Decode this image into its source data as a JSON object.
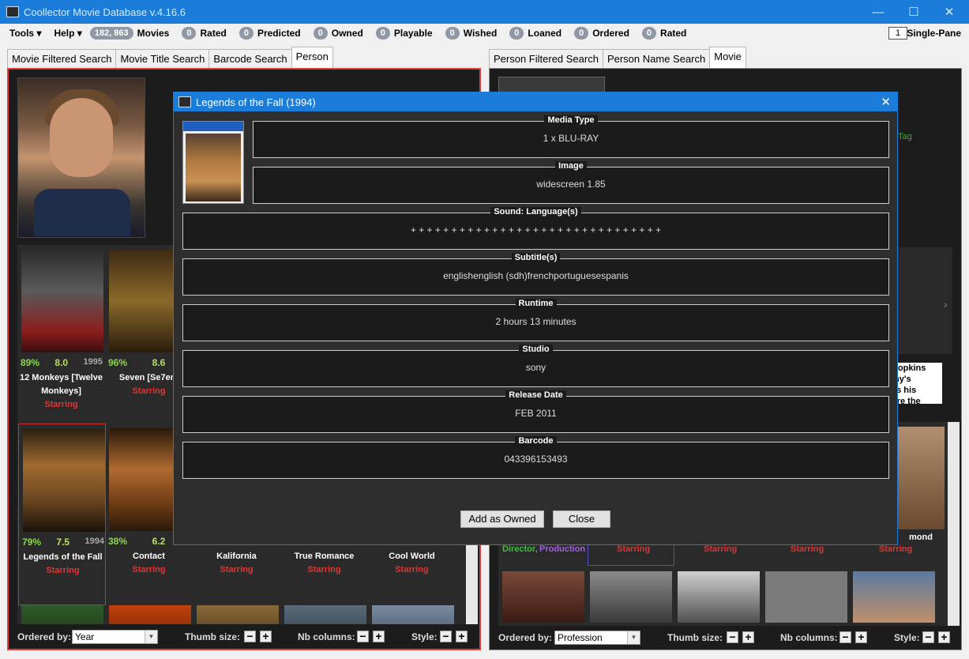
{
  "window": {
    "title": "Coollector Movie Database  v.4.16.6",
    "minimize": "—",
    "maximize": "☐",
    "close": "✕"
  },
  "menu": {
    "tools": "Tools ▾",
    "help": "Help ▾",
    "single_pane_value": "1",
    "single_pane_label": "Single-Pane"
  },
  "counters": [
    {
      "count": "182, 863",
      "label": "Movies"
    },
    {
      "count": "0",
      "label": "Rated"
    },
    {
      "count": "0",
      "label": "Predicted"
    },
    {
      "count": "0",
      "label": "Owned"
    },
    {
      "count": "0",
      "label": "Playable"
    },
    {
      "count": "0",
      "label": "Wished"
    },
    {
      "count": "0",
      "label": "Loaned"
    },
    {
      "count": "0",
      "label": "Ordered"
    },
    {
      "count": "0",
      "label": "Rated"
    }
  ],
  "left_tabs": [
    "Movie Filtered Search",
    "Movie Title Search",
    "Barcode Search",
    "Person"
  ],
  "right_tabs": [
    "Person Filtered Search",
    "Person Name Search",
    "Movie"
  ],
  "movies": [
    {
      "pct": "89%",
      "score": "8.0",
      "year": "1995",
      "title": "12 Monkeys [Twelve Monkeys]",
      "role": "Starring"
    },
    {
      "pct": "96%",
      "score": "8.6",
      "year": "",
      "title": "Seven [Se7en]",
      "role": "Starring"
    },
    {
      "pct": "79%",
      "score": "7.5",
      "year": "1994",
      "title": "Legends of the Fall",
      "role": "Starring"
    },
    {
      "pct": "38%",
      "score": "6.2",
      "year": "",
      "title": "Contact",
      "role": "Starring"
    },
    {
      "pct": "",
      "score": "",
      "year": "",
      "title": "Kalifornia",
      "role": "Starring"
    },
    {
      "pct": "",
      "score": "",
      "year": "",
      "title": "True Romance",
      "role": "Starring"
    },
    {
      "pct": "",
      "score": "",
      "year": "",
      "title": "Cool World",
      "role": "Starring"
    }
  ],
  "left_bottom": {
    "ordered_by_label": "Ordered by:",
    "ordered_by_value": "Year",
    "thumb_label": "Thumb size:",
    "cols_label": "Nb columns:",
    "style_label": "Style:"
  },
  "right_bottom": {
    "ordered_by_label": "Ordered by:",
    "ordered_by_value": "Profession",
    "thumb_label": "Thumb size:",
    "cols_label": "Nb columns:",
    "style_label": "Style:"
  },
  "right_panel": {
    "tag": "Tag",
    "text_lines": [
      "Hopkins",
      "my's",
      "es his",
      "pre the"
    ],
    "cast_name": "mond",
    "roles": {
      "director": "Director,",
      "production": "Production"
    },
    "starring": [
      "Starring",
      "Starring",
      "Starring",
      "Starring"
    ]
  },
  "modal": {
    "title": "Legends of the Fall (1994)",
    "close": "✕",
    "fields": [
      {
        "label": "Media Type",
        "value": "1 x BLU-RAY"
      },
      {
        "label": "Image",
        "value": "widescreen 1.85"
      },
      {
        "label": "Sound: Language(s)",
        "value": "+ + + + + + + + + + + + + + + + + + + + + + + + + + + + + + +"
      },
      {
        "label": "Subtitle(s)",
        "value": "englishenglish (sdh)frenchportuguesespanis"
      },
      {
        "label": "Runtime",
        "value": "2 hours 13 minutes"
      },
      {
        "label": "Studio",
        "value": "sony"
      },
      {
        "label": "Release Date",
        "value": "FEB 2011"
      },
      {
        "label": "Barcode",
        "value": "043396153493"
      }
    ],
    "add_owned": "Add as Owned",
    "close_btn": "Close"
  }
}
